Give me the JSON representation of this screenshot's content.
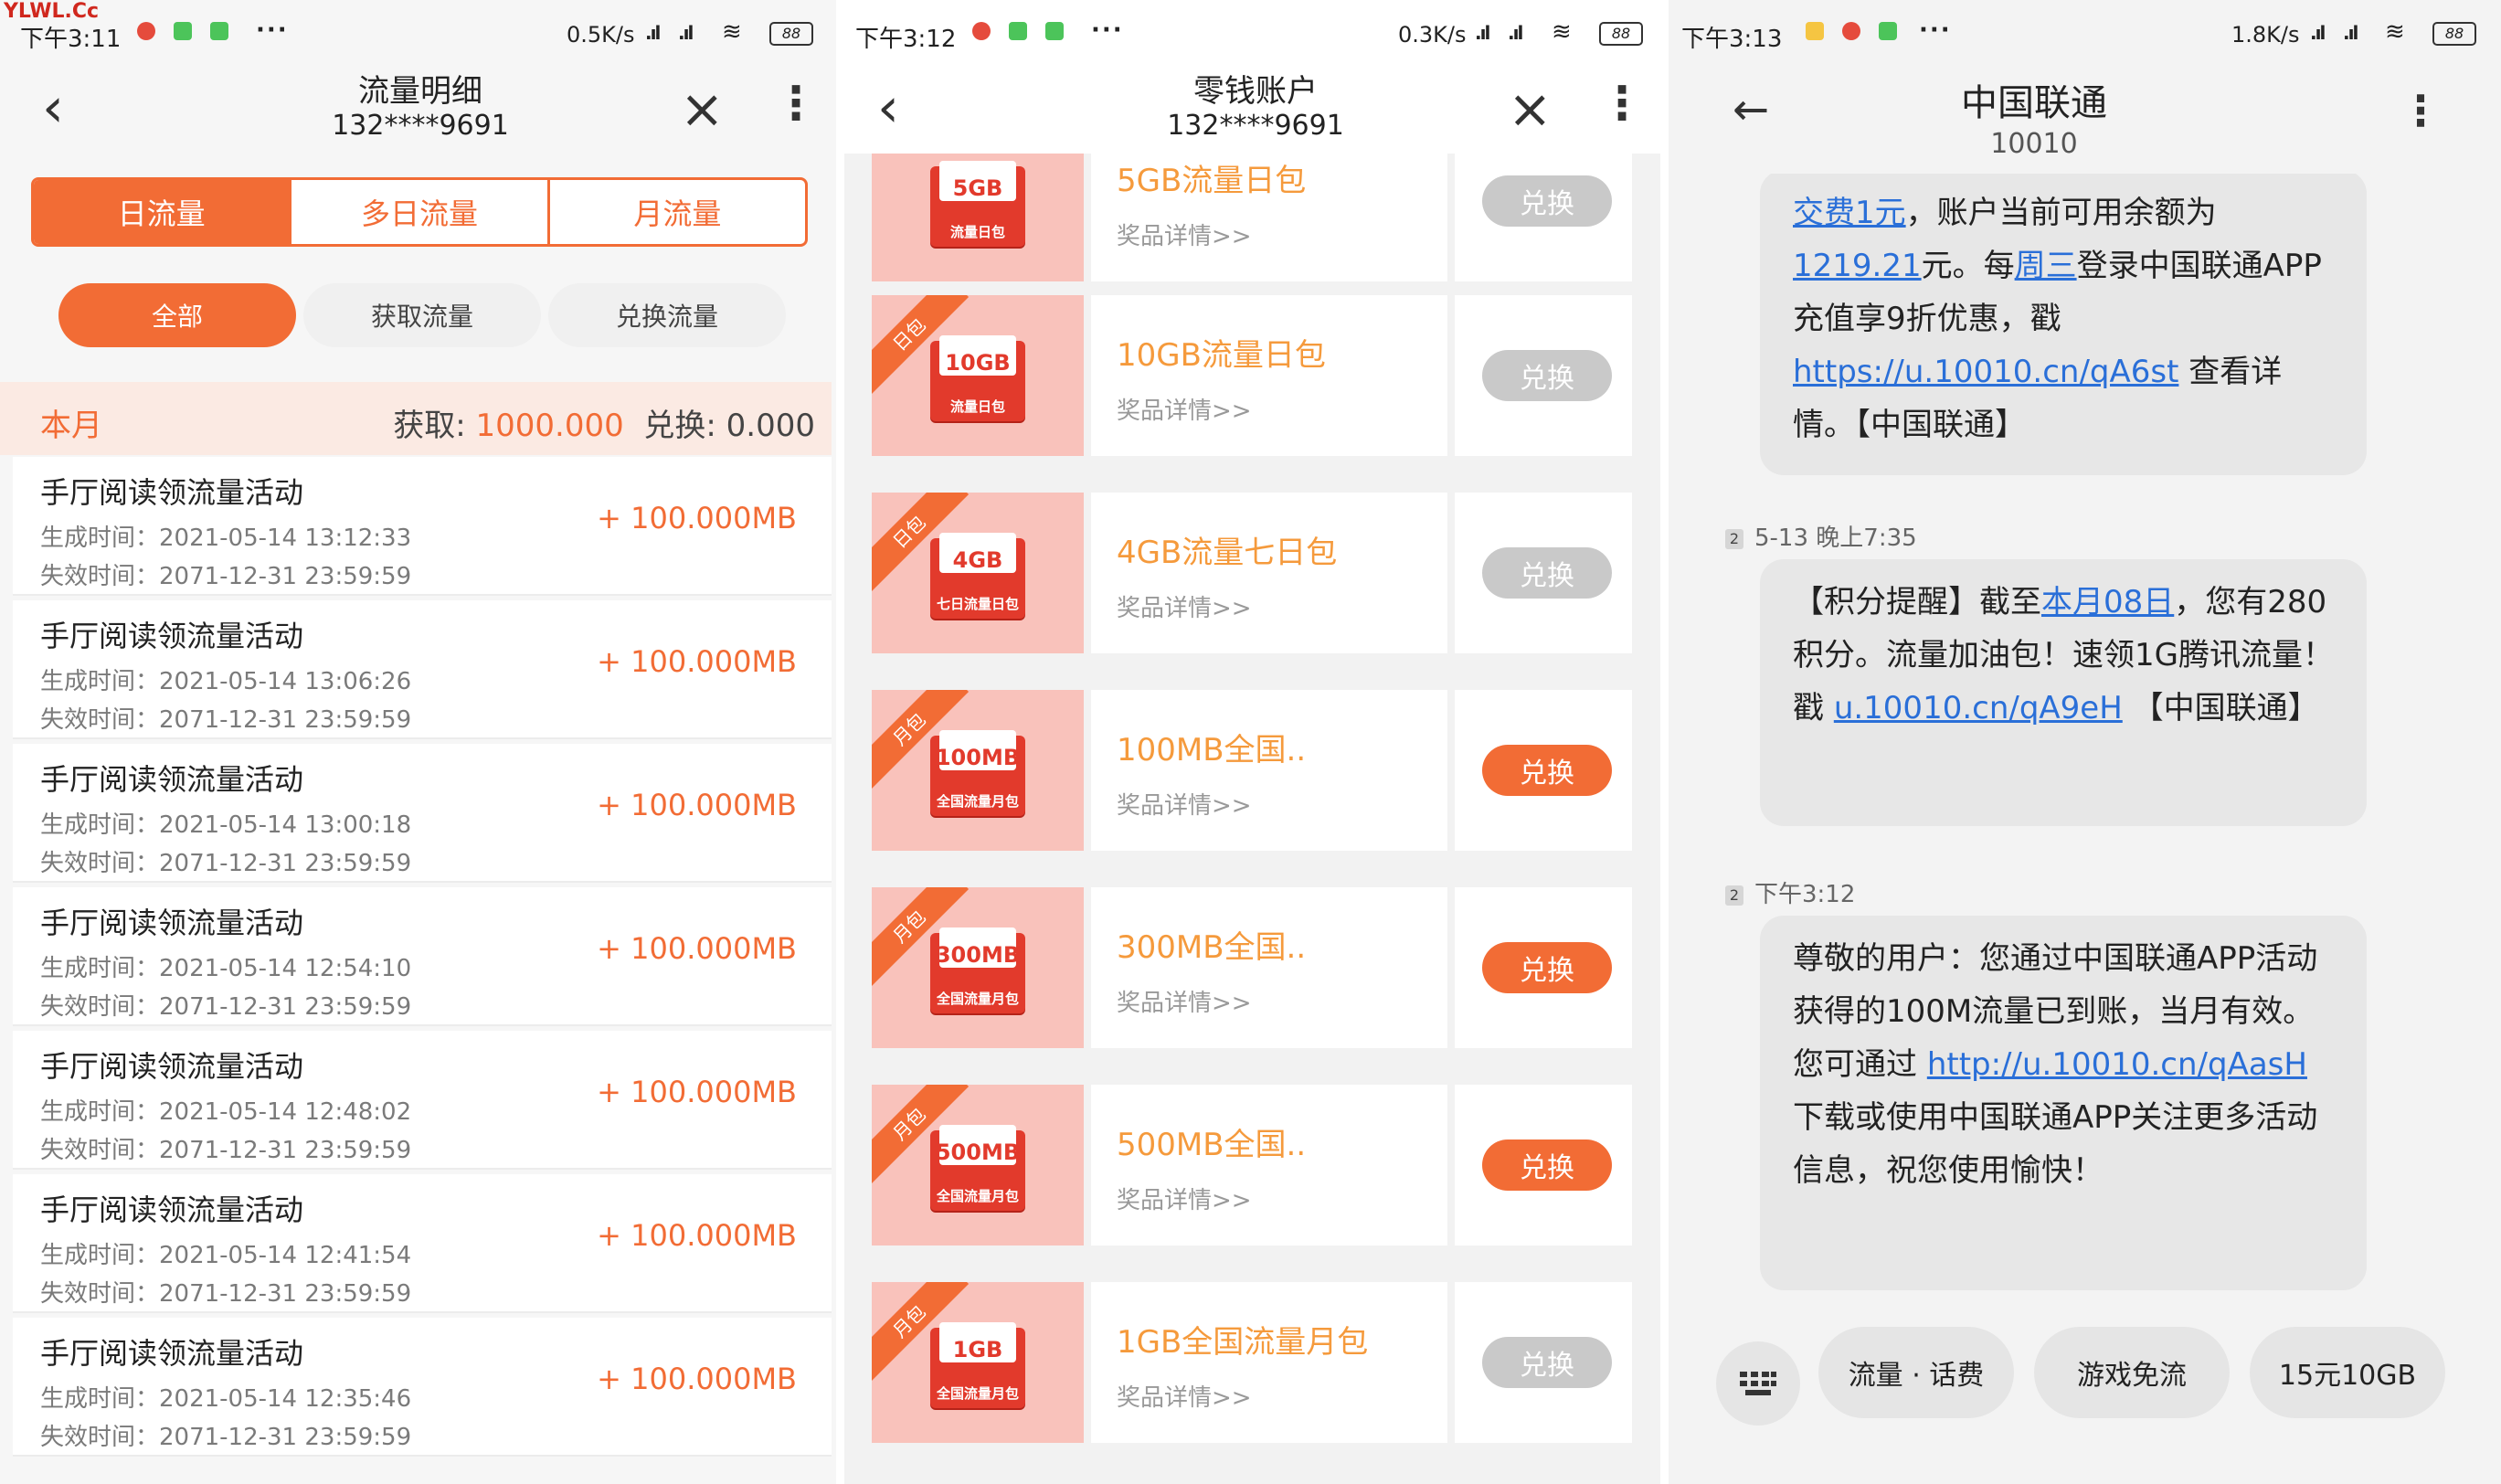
{
  "watermark": "YLWL.Cc",
  "panel1": {
    "status": {
      "time": "下午3:11",
      "dots": "···",
      "speed": "0.5K/s",
      "battery": "88"
    },
    "nav": {
      "title": "流量明细",
      "subtitle": "132****9691"
    },
    "segments": [
      "日流量",
      "多日流量",
      "月流量"
    ],
    "filters": [
      "全部",
      "获取流量",
      "兑换流量"
    ],
    "month": {
      "label": "本月",
      "obtain_label": "获取: ",
      "obtain_value": "1000.000",
      "exchange_label": "兑换: ",
      "exchange_value": "0.000"
    },
    "records": [
      {
        "title": "手厅阅读领流量活动",
        "gen": "生成时间：2021-05-14 13:12:33",
        "exp": "失效时间：2071-12-31 23:59:59",
        "amount": "+ 100.000MB"
      },
      {
        "title": "手厅阅读领流量活动",
        "gen": "生成时间：2021-05-14 13:06:26",
        "exp": "失效时间：2071-12-31 23:59:59",
        "amount": "+ 100.000MB"
      },
      {
        "title": "手厅阅读领流量活动",
        "gen": "生成时间：2021-05-14 13:00:18",
        "exp": "失效时间：2071-12-31 23:59:59",
        "amount": "+ 100.000MB"
      },
      {
        "title": "手厅阅读领流量活动",
        "gen": "生成时间：2021-05-14 12:54:10",
        "exp": "失效时间：2071-12-31 23:59:59",
        "amount": "+ 100.000MB"
      },
      {
        "title": "手厅阅读领流量活动",
        "gen": "生成时间：2021-05-14 12:48:02",
        "exp": "失效时间：2071-12-31 23:59:59",
        "amount": "+ 100.000MB"
      },
      {
        "title": "手厅阅读领流量活动",
        "gen": "生成时间：2021-05-14 12:41:54",
        "exp": "失效时间：2071-12-31 23:59:59",
        "amount": "+ 100.000MB"
      },
      {
        "title": "手厅阅读领流量活动",
        "gen": "生成时间：2021-05-14 12:35:46",
        "exp": "失效时间：2071-12-31 23:59:59",
        "amount": "+ 100.000MB"
      }
    ]
  },
  "panel2": {
    "status": {
      "time": "下午3:12",
      "dots": "···",
      "speed": "0.3K/s",
      "battery": "88"
    },
    "nav": {
      "title": "零钱账户",
      "subtitle": "132****9691"
    },
    "detail_label": "奖品详情>>",
    "items": [
      {
        "ribbon": "",
        "capacity": "5GB",
        "envelope_label": "流量日包",
        "name": "5GB流量日包",
        "button": "兑换",
        "enabled": false
      },
      {
        "ribbon": "日包",
        "capacity": "10GB",
        "envelope_label": "流量日包",
        "name": "10GB流量日包",
        "button": "兑换",
        "enabled": false
      },
      {
        "ribbon": "日包",
        "capacity": "4GB",
        "envelope_label": "七日流量日包",
        "name": "4GB流量七日包",
        "button": "兑换",
        "enabled": false
      },
      {
        "ribbon": "月包",
        "capacity": "100MB",
        "envelope_label": "全国流量月包",
        "name": "100MB全国..",
        "button": "兑换",
        "enabled": true
      },
      {
        "ribbon": "月包",
        "capacity": "300MB",
        "envelope_label": "全国流量月包",
        "name": "300MB全国..",
        "button": "兑换",
        "enabled": true
      },
      {
        "ribbon": "月包",
        "capacity": "500MB",
        "envelope_label": "全国流量月包",
        "name": "500MB全国..",
        "button": "兑换",
        "enabled": true
      },
      {
        "ribbon": "月包",
        "capacity": "1GB",
        "envelope_label": "全国流量月包",
        "name": "1GB全国流量月包",
        "button": "兑换",
        "enabled": false
      }
    ]
  },
  "panel3": {
    "status": {
      "time": "下午3:13",
      "dots": "···",
      "speed": "1.8K/s",
      "battery": "88"
    },
    "nav": {
      "title": "中国联通",
      "subtitle": "10010"
    },
    "messages": [
      {
        "meta_sim": "",
        "meta_time": "",
        "parts": [
          {
            "t": "交费1元",
            "link": true
          },
          {
            "t": "，账户当前可用余额为",
            "link": false
          },
          {
            "t": "1219.21",
            "link": true
          },
          {
            "t": "元。每",
            "link": false
          },
          {
            "t": "周三",
            "link": true
          },
          {
            "t": "登录中国联通APP充值享9折优惠，戳 ",
            "link": false
          },
          {
            "t": "https://u.10010.cn/qA6st",
            "link": true
          },
          {
            "t": " 查看详情。【中国联通】",
            "link": false
          }
        ]
      },
      {
        "meta_sim": "2",
        "meta_time": "5-13 晚上7:35",
        "parts": [
          {
            "t": "【积分提醒】截至",
            "link": false
          },
          {
            "t": "本月08日",
            "link": true
          },
          {
            "t": "，您有280积分。流量加油包！速领1G腾讯流量！戳 ",
            "link": false
          },
          {
            "t": "u.10010.cn/qA9eH",
            "link": true
          },
          {
            "t": " 【中国联通】",
            "link": false
          }
        ]
      },
      {
        "meta_sim": "2",
        "meta_time": "下午3:12",
        "parts": [
          {
            "t": "尊敬的用户：您通过中国联通APP活动获得的100M流量已到账，当月有效。您可通过 ",
            "link": false
          },
          {
            "t": "http://u.10010.cn/qAasH",
            "link": true
          },
          {
            "t": " 下载或使用中国联通APP关注更多活动信息，祝您使用愉快！",
            "link": false
          }
        ]
      }
    ],
    "quick_replies": [
      "流量 · 话费",
      "游戏免流",
      "15元10GB"
    ]
  },
  "colors": {
    "accent": "#f26c35",
    "price": "#f59a3c",
    "link": "#2a6fd8",
    "disabled": "#c9c9c9"
  }
}
